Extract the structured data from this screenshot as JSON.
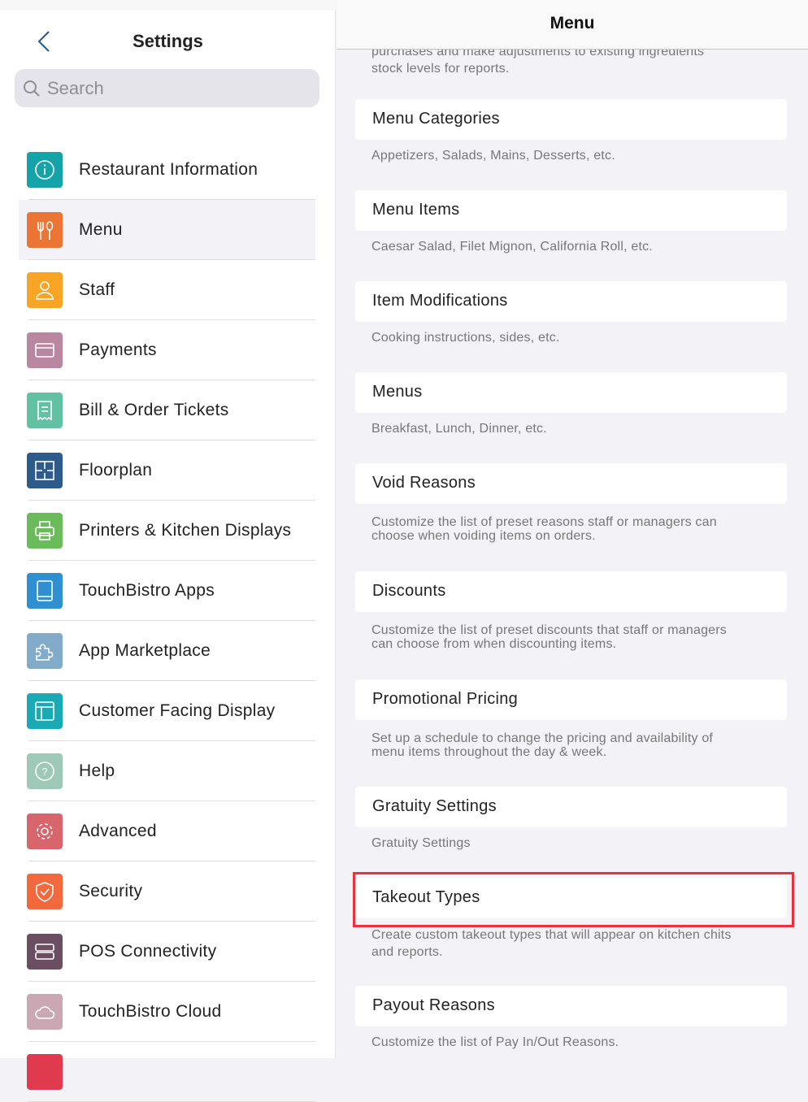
{
  "sidebar": {
    "title": "Settings",
    "search_placeholder": "Search",
    "items": [
      {
        "label": "Restaurant Information",
        "icon": "info-icon",
        "color": "#13a3a8"
      },
      {
        "label": "Menu",
        "icon": "fork-spoon-icon",
        "color": "#ec7434",
        "selected": true
      },
      {
        "label": "Staff",
        "icon": "person-icon",
        "color": "#f8a526"
      },
      {
        "label": "Payments",
        "icon": "card-icon",
        "color": "#b9879f"
      },
      {
        "label": "Bill & Order Tickets",
        "icon": "receipt-icon",
        "color": "#62c0a3"
      },
      {
        "label": "Floorplan",
        "icon": "floorplan-icon",
        "color": "#2c5b8c"
      },
      {
        "label": "Printers & Kitchen Displays",
        "icon": "printer-icon",
        "color": "#6bbb5b"
      },
      {
        "label": "TouchBistro Apps",
        "icon": "tablet-icon",
        "color": "#2f90d1"
      },
      {
        "label": "App Marketplace",
        "icon": "puzzle-icon",
        "color": "#82abc9"
      },
      {
        "label": "Customer Facing Display",
        "icon": "display-icon",
        "color": "#1aaab6"
      },
      {
        "label": "Help",
        "icon": "help-icon",
        "color": "#9dc9b6"
      },
      {
        "label": "Advanced",
        "icon": "gear-icon",
        "color": "#d8646c"
      },
      {
        "label": "Security",
        "icon": "shield-icon",
        "color": "#f1693c"
      },
      {
        "label": "POS Connectivity",
        "icon": "server-icon",
        "color": "#6c4e63"
      },
      {
        "label": "TouchBistro Cloud",
        "icon": "cloud-icon",
        "color": "#c9a7b3"
      },
      {
        "label": "",
        "icon": "",
        "color": "#e03a4f"
      }
    ]
  },
  "main": {
    "title": "Menu",
    "top_desc": [
      "purchases and make adjustments to existing ingredients",
      "stock levels for reports."
    ],
    "items": [
      {
        "label": "Menu Categories",
        "desc": [
          "Appetizers, Salads, Mains, Desserts, etc."
        ]
      },
      {
        "label": "Menu Items",
        "desc": [
          "Caesar Salad, Filet Mignon, California Roll, etc."
        ]
      },
      {
        "label": "Item Modifications",
        "desc": [
          "Cooking instructions, sides, etc."
        ]
      },
      {
        "label": "Menus",
        "desc": [
          "Breakfast, Lunch, Dinner, etc."
        ]
      },
      {
        "label": "Void Reasons",
        "desc": [
          "Customize the list of preset reasons staff or managers can",
          "choose when voiding items on orders."
        ]
      },
      {
        "label": "Discounts",
        "desc": [
          "Customize the list of preset discounts that staff or managers",
          "can choose from when discounting items."
        ]
      },
      {
        "label": "Promotional Pricing",
        "desc": [
          "Set up a schedule to change the pricing and availability of",
          "menu items throughout the day & week."
        ]
      },
      {
        "label": "Gratuity Settings",
        "desc": [
          "Gratuity Settings"
        ]
      },
      {
        "label": "Takeout Types",
        "desc": [
          "Create custom takeout types that will appear on kitchen chits",
          "and reports."
        ],
        "highlighted": true
      },
      {
        "label": "Payout Reasons",
        "desc": [
          "Customize the list of Pay In/Out Reasons."
        ]
      }
    ],
    "highlight_color": "#e8323c"
  }
}
